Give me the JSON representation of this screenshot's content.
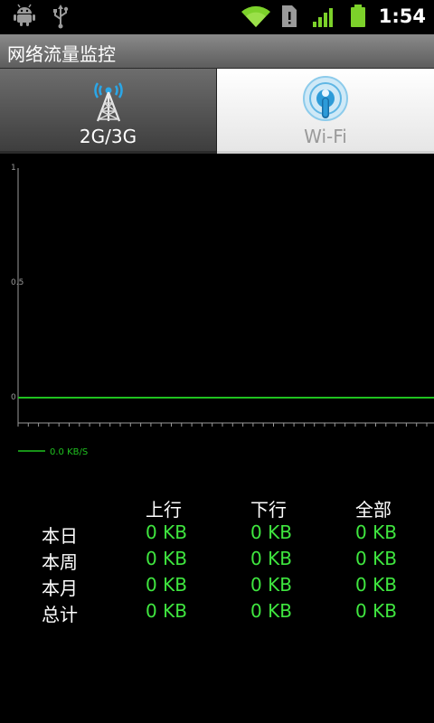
{
  "status_bar": {
    "time": "1:54",
    "icons": [
      "android-debug-icon",
      "usb-icon",
      "wifi-signal-icon",
      "sd-card-warning-icon",
      "cell-signal-icon",
      "battery-icon"
    ]
  },
  "app": {
    "title": "网络流量监控"
  },
  "tabs": [
    {
      "label": "2G/3G",
      "icon": "cell-tower-icon",
      "selected": true
    },
    {
      "label": "Wi-Fi",
      "icon": "wifi-hotspot-icon",
      "selected": false
    }
  ],
  "chart_data": {
    "type": "line",
    "title": "",
    "xlabel": "",
    "ylabel": "",
    "y_ticks": [
      "1",
      "0.5",
      "0"
    ],
    "ylim": [
      0,
      1
    ],
    "series": [
      {
        "name": "0.0 KB/S",
        "color": "#1fc21f",
        "values": [
          0,
          0,
          0,
          0,
          0,
          0,
          0,
          0,
          0,
          0
        ]
      }
    ],
    "grid": false,
    "legend": "bottom-left"
  },
  "stats": {
    "headers": [
      "上行",
      "下行",
      "全部"
    ],
    "rows": [
      {
        "label": "本日",
        "values": [
          "0 KB",
          "0 KB",
          "0 KB"
        ]
      },
      {
        "label": "本周",
        "values": [
          "0 KB",
          "0 KB",
          "0 KB"
        ]
      },
      {
        "label": "本月",
        "values": [
          "0 KB",
          "0 KB",
          "0 KB"
        ]
      },
      {
        "label": "总计",
        "values": [
          "0 KB",
          "0 KB",
          "0 KB"
        ]
      }
    ]
  },
  "colors": {
    "accent_green": "#3fe63f",
    "line_green": "#1fc21f"
  }
}
